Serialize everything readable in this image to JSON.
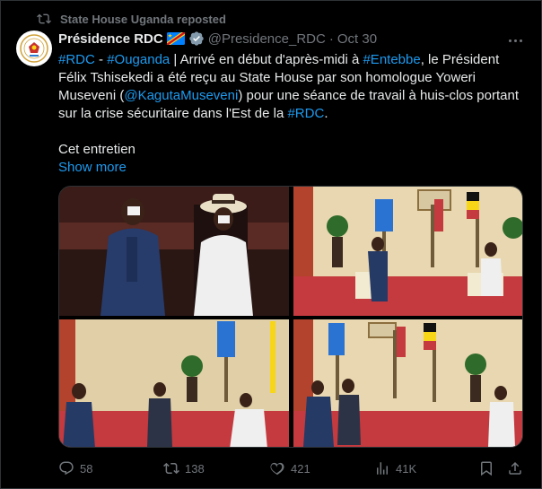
{
  "repost": {
    "icon": "repost-icon",
    "text": "State House Uganda reposted"
  },
  "author": {
    "avatar_icon": "drc-presidency-seal-icon",
    "name": "Présidence RDC",
    "flag_icon": "drc-flag-icon",
    "verified_icon": "verified-badge-icon",
    "handle": "@Presidence_RDC",
    "separator": "·",
    "date": "Oct 30"
  },
  "more_icon": "more-options-icon",
  "tweet": {
    "tag_rdc": "#RDC",
    "dash": " - ",
    "tag_ouganda": "#Ouganda",
    "text_1": " | Arrivé en début d'après-midi à ",
    "tag_entebbe": "#Entebbe",
    "text_2": ", le Président Félix Tshisekedi a été reçu au  State House par son homologue Yoweri Museveni (",
    "mention": "@KagutaMuseveni",
    "text_3": ") pour une séance de travail à huis-clos portant sur la crise sécuritaire dans l'Est de la ",
    "tag_rdc_end": "#RDC",
    "text_4": ".",
    "second_paragraph": "Cet entretien",
    "show_more": "Show more"
  },
  "media": {
    "photos": [
      "photo-tshisekedi-museveni-standing",
      "photo-meeting-wide-1",
      "photo-meeting-delegation",
      "photo-meeting-wide-2"
    ]
  },
  "actions": {
    "replies": "58",
    "reposts": "138",
    "likes": "421",
    "views": "41K"
  },
  "colors": {
    "accent": "#1d9bf0",
    "muted": "#71767b",
    "text": "#e7e9ea",
    "background": "#000000",
    "border": "#2f3336"
  }
}
